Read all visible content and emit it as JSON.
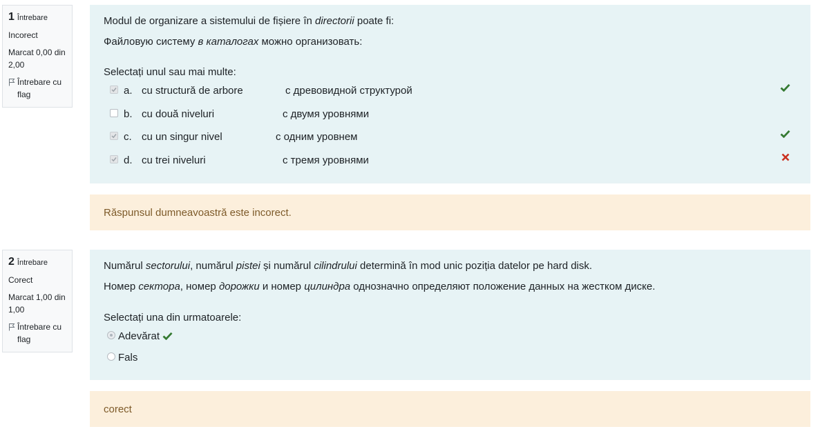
{
  "colors": {
    "correct": "#357a32",
    "incorrect": "#ca3120",
    "formulation_bg": "#e7f3f5",
    "feedback_bg": "#fcefdc",
    "feedback_text": "#7d5a29"
  },
  "questions": [
    {
      "info": {
        "number": "1",
        "word": "Întrebare",
        "state": "Incorect",
        "grade": "Marcat 0,00 din 2,00",
        "flag_label": "Întrebare cu flag"
      },
      "text_ro": {
        "before": "Modul de organizare a sistemului de fișiere în ",
        "italic": "directorii",
        "after": " poate fi:"
      },
      "text_ru": {
        "before": "Файловую систему ",
        "italic": "в каталогах",
        "after": " можно организовать:"
      },
      "prompt": "Selectați unul sau mai multe:",
      "answers": [
        {
          "letter": "a.",
          "ro": "cu structură de arbore",
          "ru": "с древовидной структурой",
          "checked": true,
          "mark": "check-icon"
        },
        {
          "letter": "b.",
          "ro": "cu două niveluri",
          "ru": "с двумя уровнями",
          "checked": false,
          "mark": ""
        },
        {
          "letter": "c.",
          "ro": "cu un singur nivel",
          "ru": "с одним уровнем",
          "checked": true,
          "mark": "check-icon"
        },
        {
          "letter": "d.",
          "ro": "cu trei niveluri",
          "ru": "с тремя уровнями",
          "checked": true,
          "mark": "cross-icon"
        }
      ],
      "feedback": "Răspunsul dumneavoastră este incorect."
    },
    {
      "info": {
        "number": "2",
        "word": "Întrebare",
        "state": "Corect",
        "grade": "Marcat 1,00 din 1,00",
        "flag_label": "Întrebare cu flag"
      },
      "text_ro": {
        "p1": "Numărul ",
        "i1": "sectorului",
        "p2": ", numărul ",
        "i2": "pistei",
        "p3": " și numărul ",
        "i3": "cilindrului",
        "p4": " determină în mod unic poziția datelor pe hard disk."
      },
      "text_ru": {
        "p1": "Номер ",
        "i1": "сектора",
        "p2": ", номер ",
        "i2": "дорожки",
        "p3": " и номер ",
        "i3": "цилиндра",
        "p4": " однозначно определяют положение данных на жестком диске."
      },
      "prompt": "Selectați una din urmatoarele:",
      "options": [
        {
          "label": "Adevărat",
          "selected": true,
          "mark": "check-icon"
        },
        {
          "label": "Fals",
          "selected": false,
          "mark": ""
        }
      ],
      "feedback": "corect"
    }
  ]
}
